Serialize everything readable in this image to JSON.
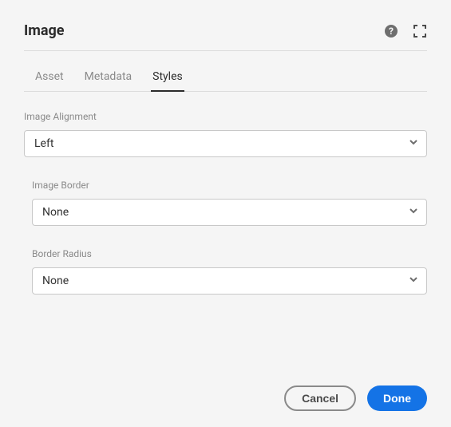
{
  "header": {
    "title": "Image"
  },
  "tabs": [
    {
      "label": "Asset",
      "active": false
    },
    {
      "label": "Metadata",
      "active": false
    },
    {
      "label": "Styles",
      "active": true
    }
  ],
  "fields": {
    "alignment": {
      "label": "Image Alignment",
      "value": "Left"
    },
    "border": {
      "label": "Image Border",
      "value": "None"
    },
    "radius": {
      "label": "Border Radius",
      "value": "None"
    }
  },
  "footer": {
    "cancel": "Cancel",
    "done": "Done"
  }
}
